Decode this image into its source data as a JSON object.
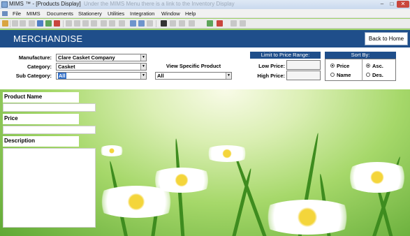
{
  "window": {
    "title": "MIMS ™ - [Products Display]",
    "overlay_text": "Under the MIMS Menu there is a link to the Inventory Display",
    "minimize": "–",
    "maximize": "□",
    "close": "✕"
  },
  "menu": {
    "items": [
      "File",
      "MIMS",
      "Documents",
      "Stationery",
      "Utilities",
      "Integration",
      "Window",
      "Help"
    ]
  },
  "toolbar": {
    "icons": [
      "home-icon",
      "back-icon",
      "forward-icon",
      "search-icon",
      "save-icon",
      "refresh-icon",
      "undo-icon",
      "redo-icon",
      "delete-icon",
      "print-icon",
      "copy-icon",
      "paste-icon",
      "binoculars-icon",
      "first-icon",
      "prev-icon",
      "next-icon",
      "last-icon",
      "filter-icon",
      "sort-icon",
      "add-icon",
      "exit-icon"
    ]
  },
  "header": {
    "title": "MERCHANDISE",
    "back_button": "Back to Home"
  },
  "filters": {
    "manufacture_label": "Manufacture:",
    "manufacture_value": "Clare Casket Company",
    "category_label": "Category:",
    "category_value": "Casket",
    "subcategory_label": "Sub Category:",
    "subcategory_value": "All",
    "view_product_label": "View Specific Product",
    "view_product_value": "All"
  },
  "price_range": {
    "heading": "Limit to Price Range:",
    "low_label": "Low Price:",
    "high_label": "High Price:",
    "low_value": "",
    "high_value": ""
  },
  "sort": {
    "heading": "Sort By:",
    "price_label": "Price",
    "name_label": "Name",
    "asc_label": "Asc.",
    "des_label": "Des.",
    "selected_field": "Price",
    "selected_order": "Asc."
  },
  "product": {
    "name_label": "Product Name",
    "price_label": "Price",
    "description_label": "Description",
    "name_value": "",
    "price_value": "",
    "description_value": ""
  },
  "colors": {
    "header_blue": "#1f4e8a",
    "selection_blue": "#3370c8",
    "close_red": "#c9463d"
  }
}
